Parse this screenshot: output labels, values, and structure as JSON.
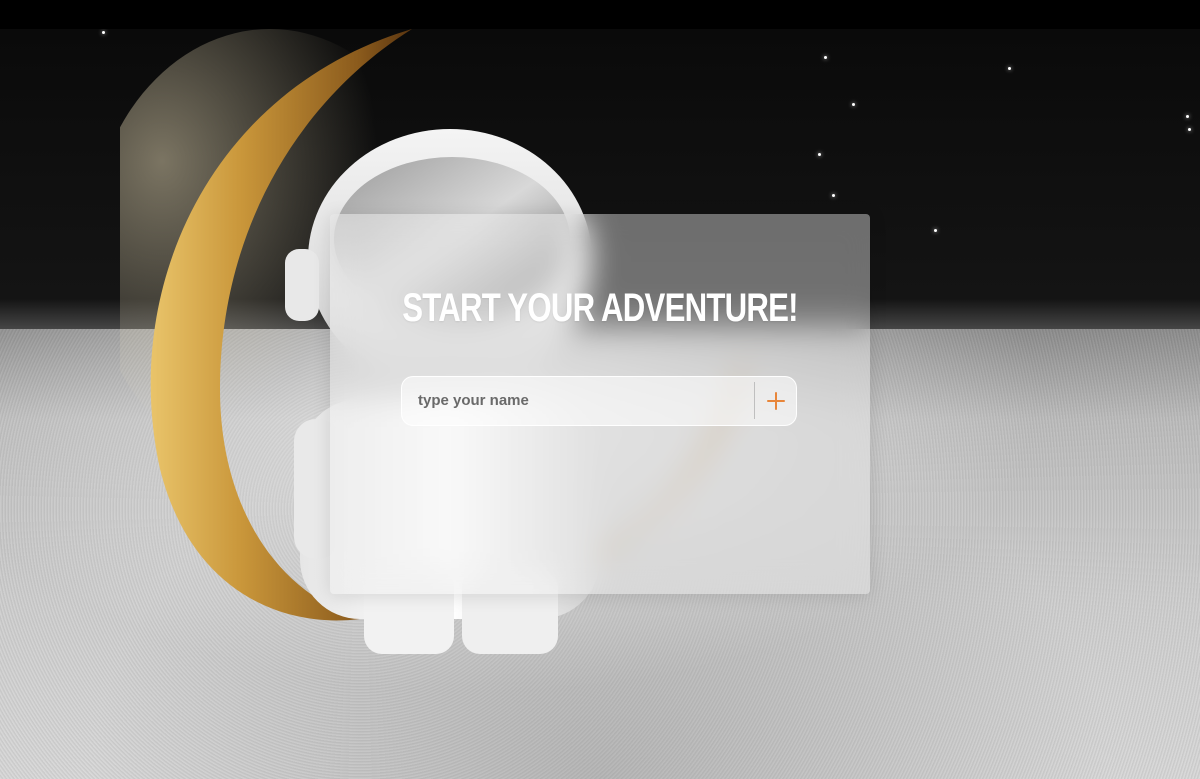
{
  "card": {
    "title": "START YOUR ADVENTURE!",
    "name_input": {
      "placeholder": "type your name",
      "value": ""
    },
    "add_button": {
      "icon": "plus-icon"
    }
  },
  "colors": {
    "accent": "#e8863a",
    "title": "#ffffff",
    "sky": "#0a0a0a",
    "ground": "#cfcfcf",
    "moon": "#c9963a"
  }
}
